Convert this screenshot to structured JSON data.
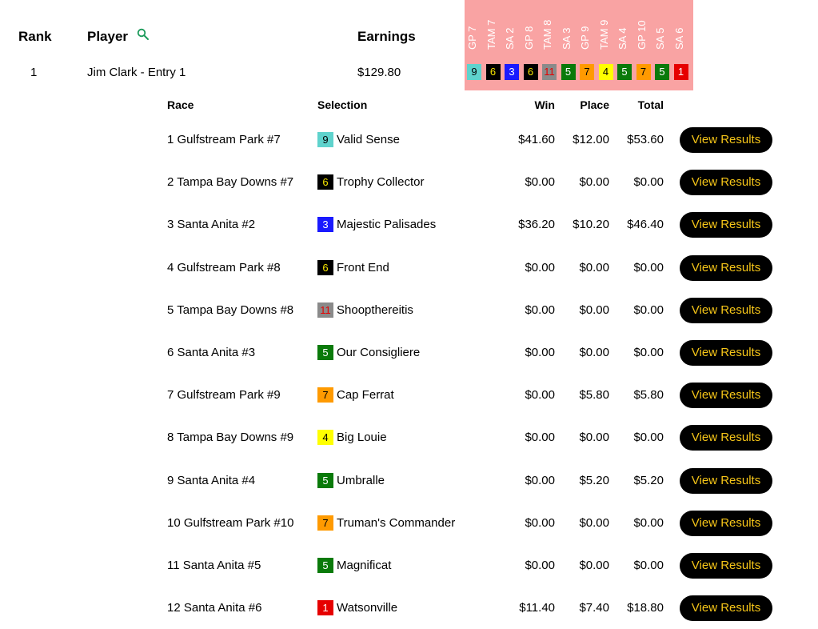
{
  "header": {
    "rank": "Rank",
    "player": "Player",
    "earnings": "Earnings"
  },
  "race_columns": [
    "GP 7",
    "TAM 7",
    "SA 2",
    "GP 8",
    "TAM 8",
    "SA 3",
    "GP 9",
    "TAM 9",
    "SA 4",
    "GP 10",
    "SA 5",
    "SA 6"
  ],
  "entry": {
    "rank": "1",
    "player": "Jim Clark - Entry 1",
    "earnings": "$129.80"
  },
  "chips": [
    {
      "num": "9",
      "bg": "#5fd3cd",
      "fg": "#000000"
    },
    {
      "num": "6",
      "bg": "#000000",
      "fg": "#f5e400"
    },
    {
      "num": "3",
      "bg": "#1a1aff",
      "fg": "#ffffff"
    },
    {
      "num": "6",
      "bg": "#000000",
      "fg": "#f5e400"
    },
    {
      "num": "11",
      "bg": "#8a8a8a",
      "fg": "#e60000"
    },
    {
      "num": "5",
      "bg": "#0a7a0a",
      "fg": "#ffffff"
    },
    {
      "num": "7",
      "bg": "#ff9a00",
      "fg": "#000000"
    },
    {
      "num": "4",
      "bg": "#ffff00",
      "fg": "#000000"
    },
    {
      "num": "5",
      "bg": "#0a7a0a",
      "fg": "#ffffff"
    },
    {
      "num": "7",
      "bg": "#ff9a00",
      "fg": "#000000"
    },
    {
      "num": "5",
      "bg": "#0a7a0a",
      "fg": "#ffffff"
    },
    {
      "num": "1",
      "bg": "#e60000",
      "fg": "#ffffff"
    }
  ],
  "detail_header": {
    "race": "Race",
    "selection": "Selection",
    "win": "Win",
    "place": "Place",
    "total": "Total"
  },
  "view_results_label": "View Results",
  "rows": [
    {
      "race": "1 Gulfstream Park #7",
      "badge": "9",
      "badge_bg": "#5fd3cd",
      "badge_fg": "#000000",
      "horse": "Valid Sense",
      "win": "$41.60",
      "place": "$12.00",
      "total": "$53.60"
    },
    {
      "race": "2 Tampa Bay Downs #7",
      "badge": "6",
      "badge_bg": "#000000",
      "badge_fg": "#f5e400",
      "horse": "Trophy Collector",
      "win": "$0.00",
      "place": "$0.00",
      "total": "$0.00"
    },
    {
      "race": "3 Santa Anita #2",
      "badge": "3",
      "badge_bg": "#1a1aff",
      "badge_fg": "#ffffff",
      "horse": "Majestic Palisades",
      "win": "$36.20",
      "place": "$10.20",
      "total": "$46.40"
    },
    {
      "race": "4 Gulfstream Park #8",
      "badge": "6",
      "badge_bg": "#000000",
      "badge_fg": "#f5e400",
      "horse": "Front End",
      "win": "$0.00",
      "place": "$0.00",
      "total": "$0.00"
    },
    {
      "race": "5 Tampa Bay Downs #8",
      "badge": "11",
      "badge_bg": "#8a8a8a",
      "badge_fg": "#e60000",
      "horse": "Shoopthereitis",
      "win": "$0.00",
      "place": "$0.00",
      "total": "$0.00"
    },
    {
      "race": "6 Santa Anita #3",
      "badge": "5",
      "badge_bg": "#0a7a0a",
      "badge_fg": "#ffffff",
      "horse": "Our Consigliere",
      "win": "$0.00",
      "place": "$0.00",
      "total": "$0.00"
    },
    {
      "race": "7 Gulfstream Park #9",
      "badge": "7",
      "badge_bg": "#ff9a00",
      "badge_fg": "#000000",
      "horse": "Cap Ferrat",
      "win": "$0.00",
      "place": "$5.80",
      "total": "$5.80"
    },
    {
      "race": "8 Tampa Bay Downs #9",
      "badge": "4",
      "badge_bg": "#ffff00",
      "badge_fg": "#000000",
      "horse": "Big Louie",
      "win": "$0.00",
      "place": "$0.00",
      "total": "$0.00"
    },
    {
      "race": "9 Santa Anita #4",
      "badge": "5",
      "badge_bg": "#0a7a0a",
      "badge_fg": "#ffffff",
      "horse": "Umbralle",
      "win": "$0.00",
      "place": "$5.20",
      "total": "$5.20"
    },
    {
      "race": "10 Gulfstream Park #10",
      "badge": "7",
      "badge_bg": "#ff9a00",
      "badge_fg": "#000000",
      "horse": "Truman's Commander",
      "win": "$0.00",
      "place": "$0.00",
      "total": "$0.00"
    },
    {
      "race": "11 Santa Anita #5",
      "badge": "5",
      "badge_bg": "#0a7a0a",
      "badge_fg": "#ffffff",
      "horse": "Magnificat",
      "win": "$0.00",
      "place": "$0.00",
      "total": "$0.00"
    },
    {
      "race": "12 Santa Anita #6",
      "badge": "1",
      "badge_bg": "#e60000",
      "badge_fg": "#ffffff",
      "horse": "Watsonville",
      "win": "$11.40",
      "place": "$7.40",
      "total": "$18.80"
    }
  ],
  "icons": {
    "player_search": "search-icon"
  },
  "colors": {
    "race_panel": "#f9a3a3",
    "button_bg": "#000000",
    "button_text": "#f5c518",
    "search_icon": "#1a9a5a"
  }
}
